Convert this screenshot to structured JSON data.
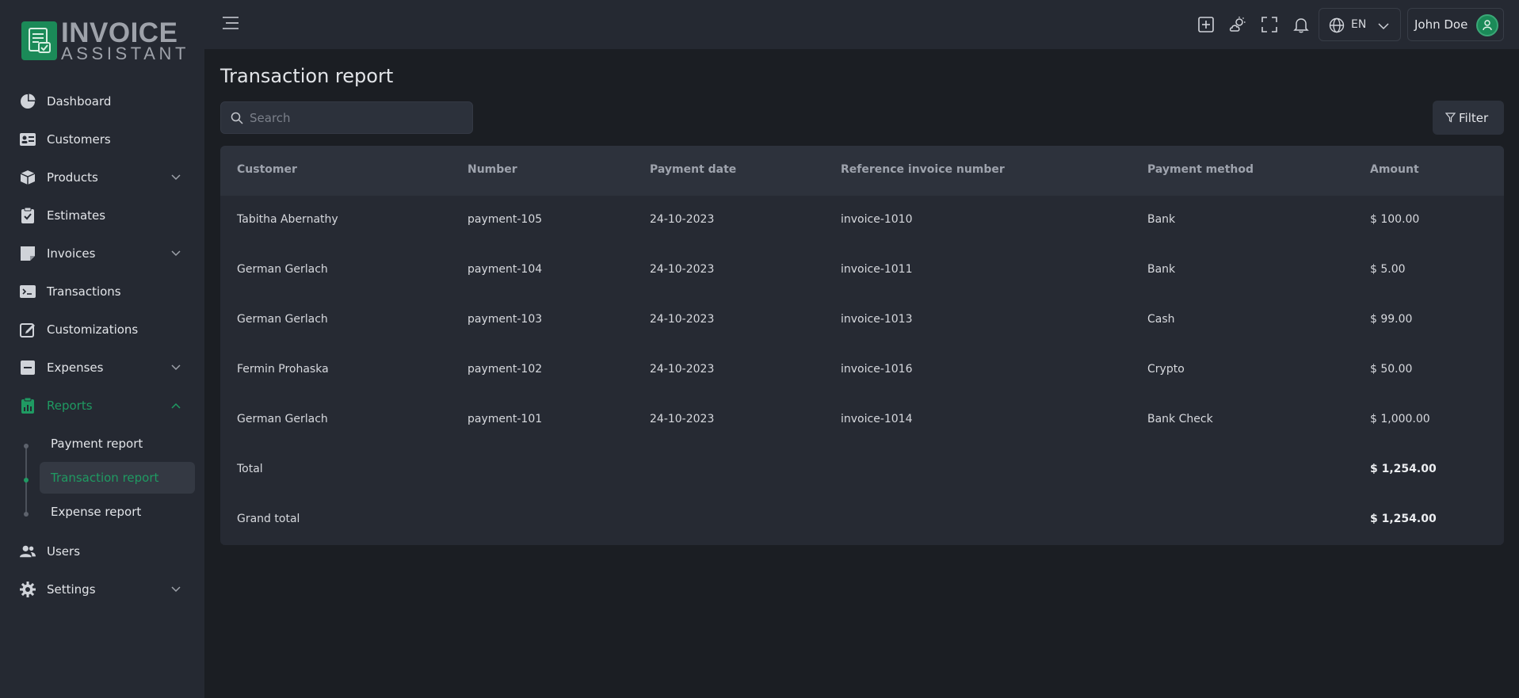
{
  "brand": {
    "line1": "INVOICE",
    "line2": "ASSISTANT"
  },
  "sidebar": {
    "items": [
      {
        "label": "Dashboard",
        "icon": "pie-chart-icon"
      },
      {
        "label": "Customers",
        "icon": "id-card-icon"
      },
      {
        "label": "Products",
        "icon": "box-icon",
        "expandable": true
      },
      {
        "label": "Estimates",
        "icon": "clipboard-icon"
      },
      {
        "label": "Invoices",
        "icon": "note-icon",
        "expandable": true
      },
      {
        "label": "Transactions",
        "icon": "terminal-icon"
      },
      {
        "label": "Customizations",
        "icon": "edit-icon"
      },
      {
        "label": "Expenses",
        "icon": "minus-square-icon",
        "expandable": true
      },
      {
        "label": "Reports",
        "icon": "report-icon",
        "expandable": true,
        "active": true
      },
      {
        "label": "Users",
        "icon": "users-icon"
      },
      {
        "label": "Settings",
        "icon": "gear-icon",
        "expandable": true
      }
    ],
    "report_subitems": [
      {
        "label": "Payment report"
      },
      {
        "label": "Transaction report",
        "active": true
      },
      {
        "label": "Expense report"
      }
    ]
  },
  "header": {
    "language": "EN",
    "user_name": "John Doe"
  },
  "page": {
    "title": "Transaction report",
    "search_placeholder": "Search",
    "filter_label": "Filter"
  },
  "table": {
    "columns": [
      "Customer",
      "Number",
      "Payment date",
      "Reference invoice number",
      "Payment method",
      "Amount"
    ],
    "rows": [
      [
        "Tabitha Abernathy",
        "payment-105",
        "24-10-2023",
        "invoice-1010",
        "Bank",
        "$ 100.00"
      ],
      [
        "German Gerlach",
        "payment-104",
        "24-10-2023",
        "invoice-1011",
        "Bank",
        "$ 5.00"
      ],
      [
        "German Gerlach",
        "payment-103",
        "24-10-2023",
        "invoice-1013",
        "Cash",
        "$ 99.00"
      ],
      [
        "Fermin Prohaska",
        "payment-102",
        "24-10-2023",
        "invoice-1016",
        "Crypto",
        "$ 50.00"
      ],
      [
        "German Gerlach",
        "payment-101",
        "24-10-2023",
        "invoice-1014",
        "Bank Check",
        "$ 1,000.00"
      ]
    ],
    "total_label": "Total",
    "total_value": "$ 1,254.00",
    "grand_total_label": "Grand total",
    "grand_total_value": "$ 1,254.00"
  },
  "colors": {
    "accent": "#1f9a62",
    "sidebar_bg": "#252932",
    "page_bg": "#1b1e23"
  }
}
